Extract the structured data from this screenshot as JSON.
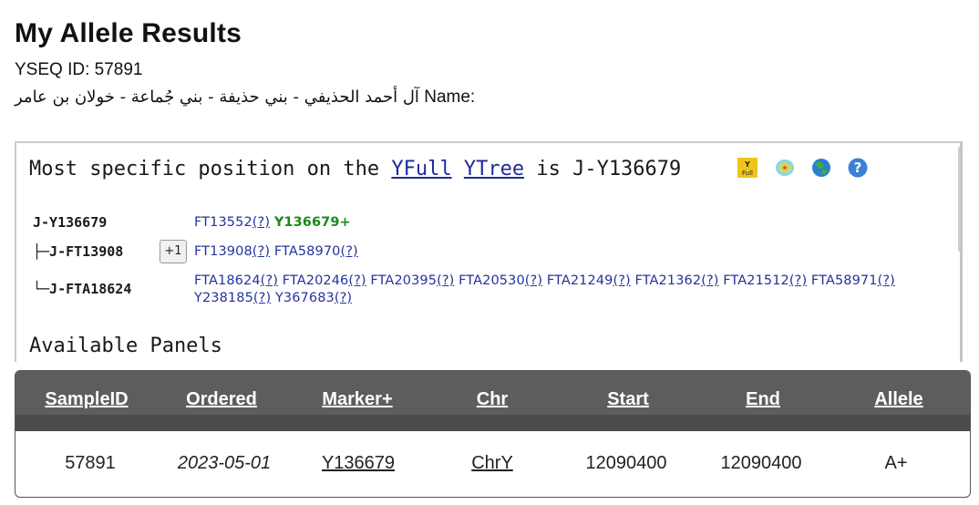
{
  "page": {
    "title": "My Allele Results",
    "yseq_label": "YSEQ ID: ",
    "yseq_id": "57891",
    "name_label": "Name:",
    "name_value": "آل أحمد الحذيفي - بني حذيفة - بني جُماعة - خولان بن عامر"
  },
  "tree_panel": {
    "prefix": "Most specific position on the",
    "yfull_link": "YFull",
    "ytree_link": "YTree",
    "is_text": "is",
    "position": "J-Y136679",
    "icons": [
      "yfull-icon",
      "heatmap-icon",
      "globe-icon",
      "help-icon"
    ],
    "rows": [
      {
        "node": "J-Y136679",
        "snps": [
          {
            "name": "FT13552",
            "q": "(?)"
          },
          {
            "name": "Y136679+",
            "highlight": true
          }
        ]
      },
      {
        "node": "├─J-FT13908",
        "plus_label": "+1",
        "snps": [
          {
            "name": "FT13908",
            "q": "(?)"
          },
          {
            "name": "FTA58970",
            "q": "(?)"
          }
        ]
      },
      {
        "node": "└─J-FTA18624",
        "snps": [
          {
            "name": "FTA18624",
            "q": "(?)"
          },
          {
            "name": "FTA20246",
            "q": "(?)"
          },
          {
            "name": "FTA20395",
            "q": "(?)"
          },
          {
            "name": "FTA20530",
            "q": "(?)"
          },
          {
            "name": "FTA21249",
            "q": "(?)"
          },
          {
            "name": "FTA21362",
            "q": "(?)"
          },
          {
            "name": "FTA21512",
            "q": "(?)"
          },
          {
            "name": "FTA58971",
            "q": "(?)"
          },
          {
            "name": "Y238185",
            "q": "(?)"
          },
          {
            "name": "Y367683",
            "q": "(?)"
          }
        ]
      }
    ],
    "available_panels": "Available Panels"
  },
  "table": {
    "columns": [
      "SampleID",
      "Ordered",
      "Marker+",
      "Chr",
      "Start",
      "End",
      "Allele"
    ],
    "rows": [
      [
        "57891",
        "2023-05-01",
        "Y136679",
        "ChrY",
        "12090400",
        "12090400",
        "A+"
      ]
    ]
  },
  "colors": {
    "link": "#1f2b99",
    "snp_link": "#23349b",
    "derived_snp": "#188a18",
    "table_header": "#5d5d5d"
  }
}
